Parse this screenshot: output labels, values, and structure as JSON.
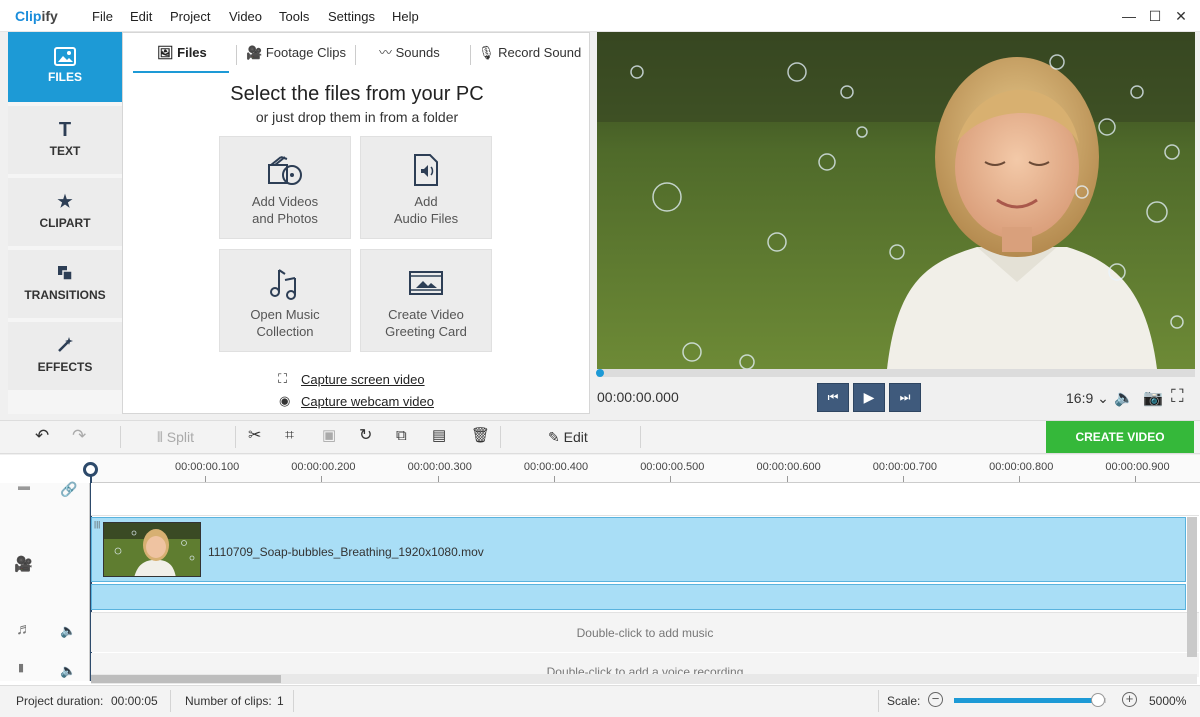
{
  "app": {
    "logo_prefix": "Clip",
    "logo_suffix": "ify"
  },
  "menu": [
    "File",
    "Edit",
    "Project",
    "Video",
    "Tools",
    "Settings",
    "Help"
  ],
  "window_controls": [
    "—",
    "☐",
    "✕"
  ],
  "left_nav": [
    {
      "label": "FILES",
      "icon": "files-icon",
      "active": true
    },
    {
      "label": "TEXT",
      "icon": "text-icon"
    },
    {
      "label": "CLIPART",
      "icon": "star-icon"
    },
    {
      "label": "TRANSITIONS",
      "icon": "transitions-icon"
    },
    {
      "label": "EFFECTS",
      "icon": "magic-wand-icon"
    }
  ],
  "tabs": [
    {
      "label": "Files",
      "icon": "image-icon",
      "active": true
    },
    {
      "label": "Footage Clips",
      "icon": "camera-icon"
    },
    {
      "label": "Sounds",
      "icon": "waveform-icon"
    },
    {
      "label": "Record Sound",
      "icon": "microphone-icon"
    }
  ],
  "files_panel": {
    "heading": "Select the files from your PC",
    "subheading": "or just drop them in from a folder",
    "tiles": [
      {
        "line1": "Add Videos",
        "line2": "and Photos",
        "icon": "media-reel-icon"
      },
      {
        "line1": "Add",
        "line2": "Audio Files",
        "icon": "audio-file-icon"
      },
      {
        "line1": "Open Music",
        "line2": "Collection",
        "icon": "music-notes-icon"
      },
      {
        "line1": "Create Video",
        "line2": "Greeting Card",
        "icon": "film-frame-icon"
      }
    ],
    "capture_screen": "Capture screen video",
    "capture_webcam": "Capture webcam video"
  },
  "player": {
    "timecode": "00:00:00.000",
    "aspect_ratio": "16:9 ⌄",
    "progress": 0
  },
  "toolbar": {
    "split": "Split",
    "edit": "Edit",
    "create_video": "CREATE VIDEO"
  },
  "timeline": {
    "ticks": [
      "00:00:00.100",
      "00:00:00.200",
      "00:00:00.300",
      "00:00:00.400",
      "00:00:00.500",
      "00:00:00.600",
      "00:00:00.700",
      "00:00:00.800",
      "00:00:00.900"
    ],
    "clip_name": "1110709_Soap-bubbles_Breathing_1920x1080.mov",
    "music_hint": "Double-click to add music",
    "voice_hint": "Double-click to add a voice recording"
  },
  "status": {
    "duration_label": "Project duration:",
    "duration_value": "00:00:05",
    "clips_label": "Number of clips:",
    "clips_value": "1",
    "scale_label": "Scale:",
    "scale_value": "5000%",
    "scale_fraction": 0.95
  },
  "colors": {
    "accent": "#1d9ad6",
    "create_button": "#35b83a",
    "clip_fill": "#a9def6",
    "player_button": "#3f5a7c"
  }
}
